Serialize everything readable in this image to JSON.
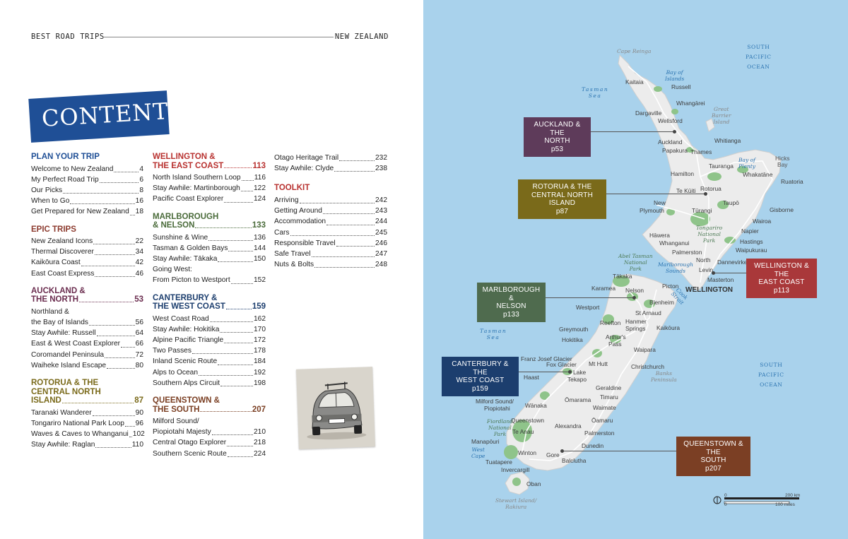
{
  "running_head": {
    "left": "BEST ROAD TRIPS",
    "right": "NEW ZEALAND"
  },
  "contents_title": "CONTENTS",
  "toc": {
    "plan": {
      "title": "PLAN YOUR TRIP",
      "entries": [
        {
          "title": "Welcome to New Zealand",
          "page": "4"
        },
        {
          "title": "My Perfect Road Trip",
          "page": "6"
        },
        {
          "title": "Our Picks",
          "page": "8"
        },
        {
          "title": "When to Go",
          "page": "16"
        },
        {
          "title": "Get Prepared for New Zealand",
          "page": "18"
        }
      ]
    },
    "epic": {
      "title": "EPIC TRIPS",
      "entries": [
        {
          "title": "New Zealand Icons",
          "page": "22"
        },
        {
          "title": "Thermal Discoverer",
          "page": "34"
        },
        {
          "title": "Kaikōura Coast",
          "page": "42"
        },
        {
          "title": "East Coast Express",
          "page": "46"
        }
      ]
    },
    "auckland": {
      "title_1": "AUCKLAND &",
      "title_2": "THE NORTH",
      "page": "53",
      "entries": [
        {
          "title_1": "Northland &",
          "title": "the Bay of Islands",
          "page": "56"
        },
        {
          "title": "Stay Awhile: Russell",
          "page": "64"
        },
        {
          "title": "East & West Coast Explorer",
          "page": "66"
        },
        {
          "title": "Coromandel Peninsula",
          "page": "72"
        },
        {
          "title": "Waiheke Island Escape",
          "page": "80"
        }
      ]
    },
    "rotorua": {
      "title_1": "ROTORUA & THE",
      "title_2": "CENTRAL NORTH",
      "title_3": "ISLAND",
      "page": "87",
      "entries": [
        {
          "title": "Taranaki Wanderer",
          "page": "90"
        },
        {
          "title": "Tongariro National Park Loop",
          "page": "96"
        },
        {
          "title": "Waves & Caves to Whanganui",
          "page": "102"
        },
        {
          "title": "Stay Awhile: Raglan",
          "page": "110"
        }
      ]
    },
    "wellington": {
      "title_1": "WELLINGTON &",
      "title_2": "THE EAST COAST",
      "page": "113",
      "entries": [
        {
          "title": "North Island Southern Loop",
          "page": "116"
        },
        {
          "title": "Stay Awhile: Martinborough",
          "page": "122"
        },
        {
          "title": "Pacific Coast Explorer",
          "page": "124"
        }
      ]
    },
    "marlborough": {
      "title_1": "MARLBOROUGH",
      "title_2": "& NELSON",
      "page": "133",
      "entries": [
        {
          "title": "Sunshine & Wine",
          "page": "136"
        },
        {
          "title": "Tasman & Golden Bays",
          "page": "144"
        },
        {
          "title": "Stay Awhile: Tākaka",
          "page": "150"
        },
        {
          "title_1": "Going West:",
          "title": "From Picton to Westport",
          "page": "152"
        }
      ]
    },
    "canterbury": {
      "title_1": "CANTERBURY &",
      "title_2": "THE WEST COAST",
      "page": "159",
      "entries": [
        {
          "title": "West Coast Road",
          "page": "162"
        },
        {
          "title": "Stay Awhile: Hokitika",
          "page": "170"
        },
        {
          "title": "Alpine Pacific Triangle",
          "page": "172"
        },
        {
          "title": "Two Passes",
          "page": "178"
        },
        {
          "title": "Inland Scenic Route",
          "page": "184"
        },
        {
          "title": "Alps to Ocean",
          "page": "192"
        },
        {
          "title": "Southern Alps Circuit",
          "page": "198"
        }
      ]
    },
    "queenstown": {
      "title_1": "QUEENSTOWN &",
      "title_2": "THE SOUTH",
      "page": "207",
      "entries": [
        {
          "title_1": "Milford Sound/",
          "title": "Piopiotahi Majesty",
          "page": "210"
        },
        {
          "title": "Central Otago Explorer",
          "page": "218"
        },
        {
          "title": "Southern Scenic Route",
          "page": "224"
        }
      ]
    },
    "misc": {
      "entries": [
        {
          "title": "Otago Heritage Trail",
          "page": "232"
        },
        {
          "title": "Stay Awhile: Clyde",
          "page": "238"
        }
      ]
    },
    "toolkit": {
      "title": "TOOLKIT",
      "entries": [
        {
          "title": "Arriving",
          "page": "242"
        },
        {
          "title": "Getting Around",
          "page": "243"
        },
        {
          "title": "Accommodation",
          "page": "244"
        },
        {
          "title": "Cars",
          "page": "245"
        },
        {
          "title": "Responsible Travel",
          "page": "246"
        },
        {
          "title": "Safe Travel",
          "page": "247"
        },
        {
          "title": "Nuts & Bolts",
          "page": "248"
        }
      ]
    }
  },
  "map": {
    "regions": {
      "auckland": {
        "line1": "AUCKLAND & THE",
        "line2": "NORTH",
        "page": "p53"
      },
      "rotorua": {
        "line1": "ROTORUA & THE",
        "line2": "CENTRAL NORTH ISLAND",
        "page": "p87"
      },
      "wellington": {
        "line1": "WELLINGTON & THE",
        "line2": "EAST COAST",
        "page": "p113"
      },
      "marlborough": {
        "line1": "MARLBOROUGH &",
        "line2": "NELSON",
        "page": "p133"
      },
      "canterbury": {
        "line1": "CANTERBURY & THE",
        "line2": "WEST COAST",
        "page": "p159"
      },
      "queenstown": {
        "line1": "QUEENSTOWN & THE",
        "line2": "SOUTH",
        "page": "p207"
      }
    },
    "places": {
      "cape_reinga": "Cape Reinga",
      "kaitaia": "Kaitaia",
      "russell": "Russell",
      "whangarei": "Whangārei",
      "dargaville": "Dargaville",
      "wellsford": "Wellsford",
      "whitianga": "Whitianga",
      "auckland": "Auckland",
      "papakura": "Papakura",
      "thames": "Thames",
      "tauranga": "Tauranga",
      "whakatane": "Whakatāne",
      "hamilton": "Hamilton",
      "rotorua": "Rotorua",
      "te_kuiti": "Te Kūiti",
      "taupo": "Taupō",
      "ruatoria": "Ruatoria",
      "gisborne": "Gisborne",
      "new_plymouth_1": "New",
      "new_plymouth_2": "Plymouth",
      "turangi": "Tūrangi",
      "wairoa": "Wairoa",
      "hawera": "Hāwera",
      "napier": "Napier",
      "whanganui": "Whanganui",
      "hastings": "Hastings",
      "waipukurau": "Waipukurau",
      "palmerston_north_1": "Palmerston",
      "palmerston_north_2": "North",
      "dannevirke": "Dannevirke",
      "levin": "Levin",
      "masterton": "Masterton",
      "wellington": "WELLINGTON",
      "takaka": "Tākaka",
      "karamea": "Karamea",
      "nelson": "Nelson",
      "picton": "Picton",
      "blenheim": "Blenheim",
      "westport": "Westport",
      "st_arnaud": "St Arnaud",
      "reefton": "Reefton",
      "hanmer_1": "Hanmer",
      "hanmer_2": "Springs",
      "kaikoura": "Kaikōura",
      "greymouth": "Greymouth",
      "hokitika": "Hokitika",
      "arthurs_1": "Arthur's",
      "arthurs_2": "Pass",
      "waipara": "Waipara",
      "franz_josef": "Franz Josef Glacier",
      "fox_glacier": "Fox Glacier",
      "mt_hutt": "Mt Hutt",
      "christchurch": "Christchurch",
      "haast": "Haast",
      "lake_tekapo_1": "Lake",
      "lake_tekapo_2": "Tekapo",
      "geraldine": "Geraldine",
      "timaru": "Timaru",
      "milford_1": "Milford Sound/",
      "milford_2": "Piopiotahi",
      "wanaka": "Wānaka",
      "omarama": "Ōmarama",
      "waimate": "Waimate",
      "queenstown": "Queenstown",
      "oamaru": "Ōamaru",
      "te_anau": "Te Anau",
      "alexandra": "Alexandra",
      "palmerston": "Palmerston",
      "manapouri": "Manapōuri",
      "dunedin": "Dunedin",
      "winton": "Winton",
      "gore": "Gore",
      "tuatapere": "Tuatapere",
      "balclutha": "Balclutha",
      "invercargill": "Invercargill",
      "oban": "Oban"
    },
    "water": {
      "tasman_sea_1a": "Tasman",
      "tasman_sea_1b": "Sea",
      "tasman_sea_2a": "Tasman",
      "tasman_sea_2b": "Sea",
      "bay_of_islands_1": "Bay of",
      "bay_of_islands_2": "Islands",
      "bay_of_plenty_1": "Bay of",
      "bay_of_plenty_2": "Plenty",
      "cook_strait_1": "Cook",
      "cook_strait_2": "Strait",
      "marlborough_sounds_1": "Marlborough",
      "marlborough_sounds_2": "Sounds",
      "west_cape_1": "West",
      "west_cape_2": "Cape",
      "spo_1a": "SOUTH",
      "spo_1b": "PACIFIC",
      "spo_1c": "OCEAN",
      "spo_2a": "SOUTH",
      "spo_2b": "PACIFIC",
      "spo_2c": "OCEAN"
    },
    "parks": {
      "tongariro_1": "Tongariro",
      "tongariro_2": "National",
      "tongariro_3": "Park",
      "abel_tasman_1": "Abel Tasman",
      "abel_tasman_2": "National",
      "abel_tasman_3": "Park",
      "fiordland_1": "Fiordland",
      "fiordland_2": "National",
      "fiordland_3": "Park"
    },
    "features": {
      "great_barrier_1": "Great",
      "great_barrier_2": "Barrier",
      "great_barrier_3": "Island",
      "hicks_bay_1": "Hicks",
      "hicks_bay_2": "Bay",
      "banks_1": "Banks",
      "banks_2": "Peninsula",
      "stewart_1": "Stewart Island/",
      "stewart_2": "Rakiura"
    },
    "scale": {
      "km": "200 km",
      "miles": "100 miles",
      "zero_a": "0",
      "zero_b": "0"
    },
    "colors": {
      "sea": "#a9d2ec",
      "land": "#ececec",
      "park": "#8fc48a",
      "road": "#ffffff"
    }
  }
}
